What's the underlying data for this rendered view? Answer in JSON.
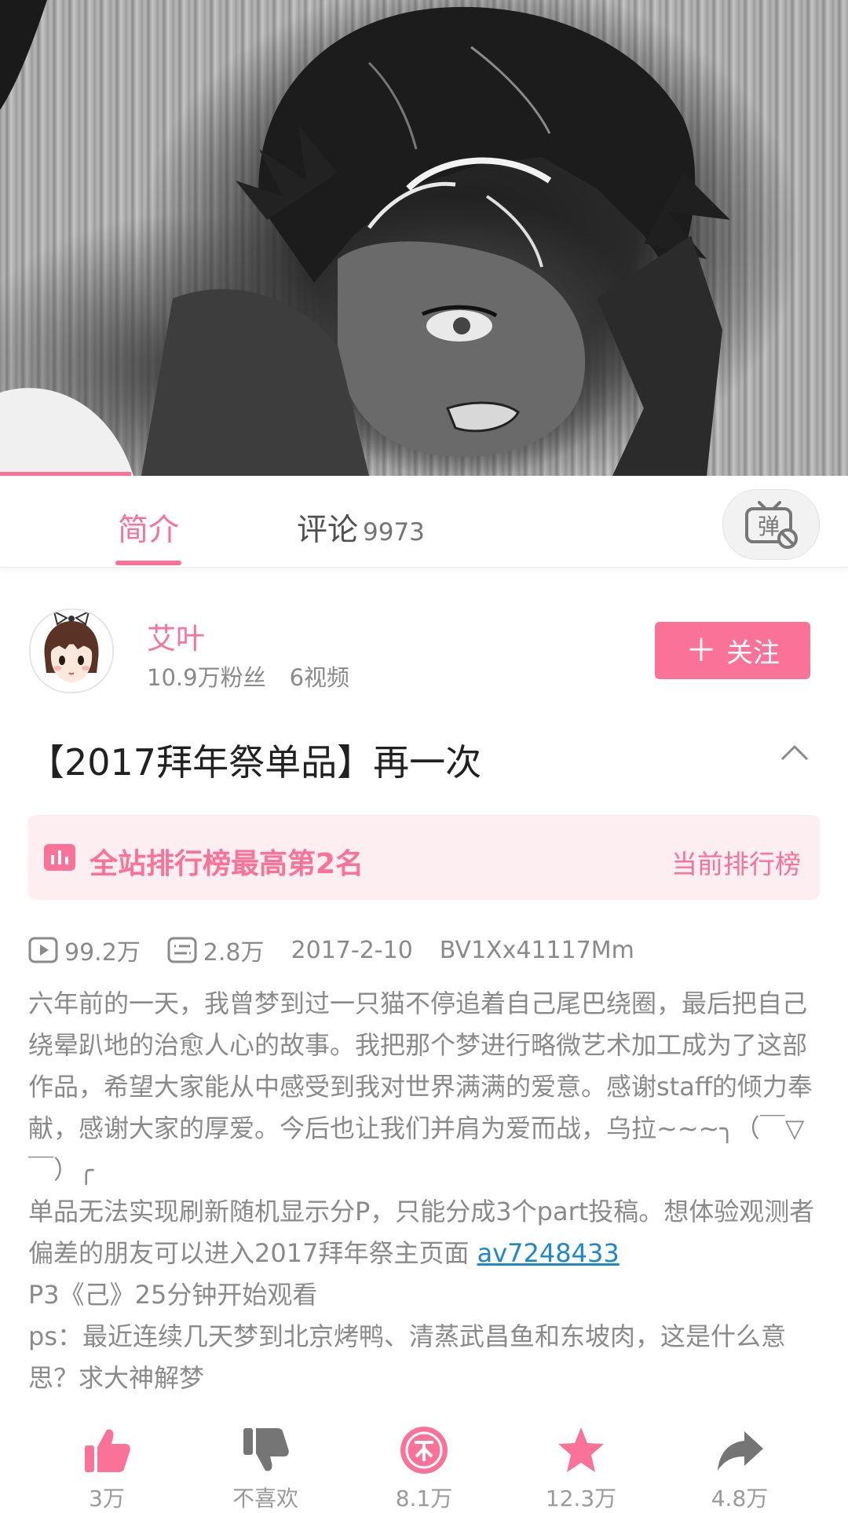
{
  "player": {
    "progress_fraction": 0.155
  },
  "tabs": {
    "intro_label": "简介",
    "comments_label": "评论",
    "comments_count": "9973",
    "danmaku_glyph": "弹"
  },
  "uploader": {
    "name": "艾叶",
    "followers": "10.9万粉丝",
    "videos": "6视频",
    "follow_label": "关注",
    "follow_plus": "＋"
  },
  "video": {
    "title": "【2017拜年祭单品】再一次",
    "ranking_text": "全站排行榜最高第2名",
    "ranking_link": "当前排行榜",
    "views": "99.2万",
    "danmaku_count": "2.8万",
    "date": "2017-2-10",
    "bvid": "BV1Xx41117Mm",
    "description": {
      "p1": "六年前的一天，我曾梦到过一只猫不停追着自己尾巴绕圈，最后把自己绕晕趴地的治愈人心的故事。我把那个梦进行略微艺术加工成为了这部作品，希望大家能从中感受到我对世界满满的爱意。感谢staff的倾力奉献，感谢大家的厚爱。今后也让我们并肩为爱而战，乌拉~~~╮（￣▽￣）╭",
      "p2_text": "单品无法实现刷新随机显示分P，只能分成3个part投稿。想体验观测者偏差的朋友可以进入2017拜年祭主页面 ",
      "p2_link": "av7248433",
      "p3": "P3《己》25分钟开始观看",
      "p4": "ps：最近连续几天梦到北京烤鸭、清蒸武昌鱼和东坡肉，这是什么意思？求大神解梦"
    }
  },
  "actions": {
    "like": "3万",
    "dislike": "不喜欢",
    "coin": "8.1万",
    "favorite": "12.3万",
    "share": "4.8万"
  },
  "colors": {
    "accent": "#fb7299",
    "link": "#1e88c8",
    "muted_text": "#8a8a8a"
  }
}
